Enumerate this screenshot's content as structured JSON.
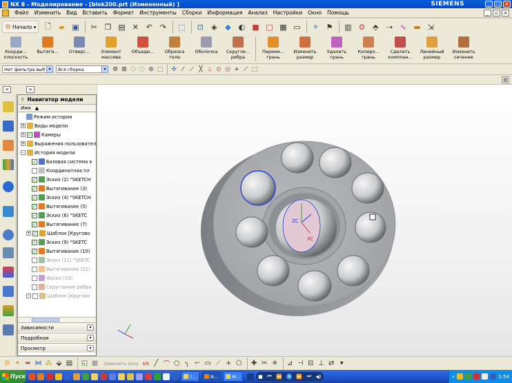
{
  "window": {
    "title": "NX 8 - Моделирование - [blok200.prt (Измененный) ]",
    "brand": "SIEMENS"
  },
  "menu": {
    "items": [
      "Файл",
      "Изменить",
      "Вид",
      "Вставить",
      "Формат",
      "Инструменты",
      "Сборки",
      "Информация",
      "Анализ",
      "Настройки",
      "Окно",
      "Помощь"
    ]
  },
  "standard_toolbar": {
    "start_label": "Начало"
  },
  "feature_toolbar": {
    "buttons": [
      {
        "label": "Коорди...\nплоскость",
        "color": "#9aa8c8"
      },
      {
        "label": "Вытяги...",
        "color": "#e07a20"
      },
      {
        "label": "Отверс...",
        "color": "#7a8ab0"
      },
      {
        "label": "Элемент\nмассива",
        "color": "#e0a030"
      },
      {
        "label": "Объеди...",
        "color": "#d05040"
      },
      {
        "label": "Обрезка\nтела",
        "color": "#c08040"
      },
      {
        "label": "Оболочка",
        "color": "#9a9ab0"
      },
      {
        "label": "Скругле...\nребра",
        "color": "#c07050"
      },
      {
        "label": "Переме...\nгрань",
        "color": "#e09030"
      },
      {
        "label": "Изменить\nразмер",
        "color": "#d07040"
      },
      {
        "label": "Удалить\nгрань",
        "color": "#c060c0"
      },
      {
        "label": "Копиро...\nгрань",
        "color": "#d08050"
      },
      {
        "label": "Сделать\nкомплан...",
        "color": "#c05050"
      },
      {
        "label": "Линейный\nразмер",
        "color": "#e0a040"
      },
      {
        "label": "Изменить\nсечение",
        "color": "#b07040"
      }
    ]
  },
  "selection_bar": {
    "filter_value": "Нет фильтра выб",
    "scope_value": "Вся сборка"
  },
  "navigator": {
    "title": "Навигатор модели",
    "column": "Имя",
    "items": [
      {
        "label": "Режим истории",
        "indent": 1,
        "exp": "",
        "chk": "none",
        "color": "#7a9ad0",
        "dim": false
      },
      {
        "label": "Виды модели",
        "indent": 0,
        "exp": "+",
        "chk": "none",
        "color": "#e0b040",
        "dim": false
      },
      {
        "label": "Камеры",
        "indent": 0,
        "exp": "+",
        "chk": "on",
        "color": "#c050c0",
        "dim": false
      },
      {
        "label": "Выражения пользовател",
        "indent": 0,
        "exp": "+",
        "chk": "none",
        "color": "#e0b040",
        "dim": false
      },
      {
        "label": "История модели",
        "indent": 0,
        "exp": "-",
        "chk": "none",
        "color": "#e0b040",
        "dim": false
      },
      {
        "label": "Базовая система к",
        "indent": 2,
        "exp": "",
        "chk": "on",
        "color": "#5070c0",
        "dim": false
      },
      {
        "label": "Координатная пл",
        "indent": 2,
        "exp": "",
        "chk": "off",
        "color": "#c0c0c0",
        "dim": false
      },
      {
        "label": "Эскиз (2) \"SKETCH",
        "indent": 2,
        "exp": "",
        "chk": "on",
        "color": "#5a9a5a",
        "dim": false
      },
      {
        "label": "Вытягивание (3)",
        "indent": 2,
        "exp": "",
        "chk": "on",
        "color": "#e07a20",
        "dim": false
      },
      {
        "label": "Эскиз (4) \"SKETCH",
        "indent": 2,
        "exp": "",
        "chk": "on",
        "color": "#5a9a5a",
        "dim": false
      },
      {
        "label": "Вытягивание (5)",
        "indent": 2,
        "exp": "",
        "chk": "on",
        "color": "#e07a20",
        "dim": false
      },
      {
        "label": "Эскиз (6) \"SKETC",
        "indent": 2,
        "exp": "",
        "chk": "on",
        "color": "#5a9a5a",
        "dim": false
      },
      {
        "label": "Вытягивание (7)",
        "indent": 2,
        "exp": "",
        "chk": "on",
        "color": "#e07a20",
        "dim": false
      },
      {
        "label": "Шаблон [Кругово",
        "indent": 1,
        "exp": "+",
        "chk": "on",
        "color": "#e0a030",
        "dim": false
      },
      {
        "label": "Эскиз (9) \"SKETC",
        "indent": 2,
        "exp": "",
        "chk": "on",
        "color": "#5a9a5a",
        "dim": false
      },
      {
        "label": "Вытягивание (10)",
        "indent": 2,
        "exp": "",
        "chk": "on",
        "color": "#e07a20",
        "dim": false
      },
      {
        "label": "Эскиз (11) \"SKETC",
        "indent": 2,
        "exp": "",
        "chk": "off",
        "color": "#a0c0a0",
        "dim": true
      },
      {
        "label": "Вытягивание (12)",
        "indent": 2,
        "exp": "",
        "chk": "off",
        "color": "#f0c090",
        "dim": true
      },
      {
        "label": "Фаска (13)",
        "indent": 2,
        "exp": "",
        "chk": "off",
        "color": "#c0a0d0",
        "dim": true
      },
      {
        "label": "Скругление ребра",
        "indent": 2,
        "exp": "",
        "chk": "off",
        "color": "#e0b0a0",
        "dim": true
      },
      {
        "label": "Шаблон [Кругово",
        "indent": 1,
        "exp": "+",
        "chk": "off",
        "color": "#e0c080",
        "dim": true
      }
    ],
    "sections": [
      "Зависимости",
      "Подробная",
      "Просмотр"
    ]
  },
  "graphics": {
    "csys_labels": [
      "ZC",
      "XC"
    ]
  },
  "bottom_toolbar": {
    "zoom_label": "Заменить зону"
  },
  "taskbar": {
    "start_label": "Пуск",
    "tasks": [
      "т...",
      "N...",
      "М..."
    ],
    "clock": "1:54"
  },
  "colors": {
    "accent": "#0a5fd8",
    "part_face": "#a9abae",
    "selection": "#1a3adb"
  }
}
